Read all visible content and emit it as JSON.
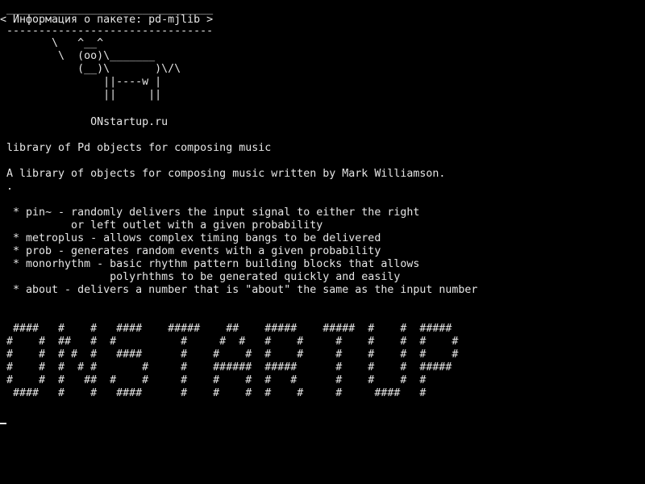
{
  "terminal": {
    "colors": {
      "background": "#000000",
      "foreground": "#e6e6e6"
    },
    "cowsay": {
      "bubble_top": " ________________________________",
      "bubble_text": "< Информация о пакете: pd-mjlib >",
      "bubble_bottom": " --------------------------------",
      "cow": [
        "        \\   ^__^",
        "         \\  (oo)\\_______",
        "            (__)\\       )\\/\\",
        "                ||----w |",
        "                ||     ||"
      ]
    },
    "site": "              ONstartup.ru",
    "package": {
      "summary": " library of Pd objects for composing music",
      "description": " A library of objects for composing music written by Mark Williamson.",
      "dot": " .",
      "objects": [
        "  * pin~ - randomly delivers the input signal to either the right",
        "           or left outlet with a given probability",
        "  * metroplus - allows complex timing bangs to be delivered",
        "  * prob - generates random events with a given probability",
        "  * monorhythm - basic rhythm pattern building blocks that allows",
        "                 polyrhthms to be generated quickly and easily",
        "  * about - delivers a number that is \"about\" the same as the input number"
      ]
    },
    "banner": [
      "  ####   #    #   ####    #####    ##    #####    #####  #    #  #####",
      " #    #  ##   #  #          #     #  #   #    #     #    #    #  #    #",
      " #    #  # #  #   ####      #    #    #  #    #     #    #    #  #    #",
      " #    #  #  # #       #     #    ######  #####      #    #    #  #####",
      " #    #  #   ##  #    #     #    #    #  #   #      #    #    #  #",
      "  ####   #    #   ####      #    #    #  #    #     #     ####   #"
    ]
  }
}
